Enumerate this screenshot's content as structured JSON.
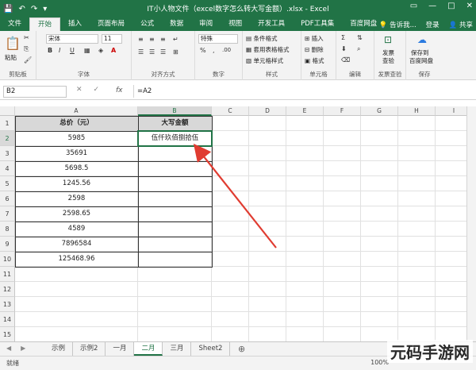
{
  "window": {
    "title": "IT小人物文件（excel数字怎么转大写金额）.xlsx - Excel",
    "min": "—",
    "max": "□",
    "close": "✕",
    "restore": "▭"
  },
  "quick_access": {
    "save": "💾",
    "undo": "↶",
    "redo": "↷",
    "more": "▾"
  },
  "tabs": [
    "文件",
    "开始",
    "插入",
    "页面布局",
    "公式",
    "数据",
    "审阅",
    "视图",
    "开发工具",
    "PDF工具集",
    "百度网盘"
  ],
  "tell_me": "告诉我...",
  "login": "登录",
  "share": "共享",
  "ribbon": {
    "clipboard": {
      "paste": "粘贴",
      "label": "剪贴板"
    },
    "font": {
      "name": "宋体",
      "size": "11",
      "bold": "B",
      "italic": "I",
      "underline": "U",
      "label": "字体"
    },
    "align": {
      "label": "对齐方式"
    },
    "number": {
      "format": "特殊",
      "label": "数字"
    },
    "styles": {
      "cond": "条件格式",
      "table": "套用表格格式",
      "cell": "单元格样式",
      "label": "样式"
    },
    "cells": {
      "insert": "插入",
      "delete": "删除",
      "format": "格式",
      "label": "单元格"
    },
    "edit": {
      "label": "编辑"
    },
    "invoice": {
      "text": "发票查验",
      "line1": "发票",
      "line2": "查验"
    },
    "save": {
      "line1": "保存到",
      "line2": "百度网盘",
      "label": "保存"
    }
  },
  "formula_bar": {
    "name_box": "B2",
    "cancel": "✕",
    "enter": "✓",
    "fx": "fx",
    "formula": "=A2"
  },
  "columns": [
    "A",
    "B",
    "C",
    "D",
    "E",
    "F",
    "G",
    "H",
    "I"
  ],
  "rows": [
    "1",
    "2",
    "3",
    "4",
    "5",
    "6",
    "7",
    "8",
    "9",
    "10",
    "11",
    "12",
    "13",
    "14",
    "15"
  ],
  "table": {
    "header_a": "总价（元）",
    "header_b": "大写金额",
    "values_a": [
      "5985",
      "35691",
      "5698.5",
      "1245.56",
      "2598",
      "2598.65",
      "4589",
      "7896584",
      "125468.96"
    ],
    "b2": "伍仟玖佰捌拾伍"
  },
  "sheets": [
    "示例",
    "示例2",
    "一月",
    "二月",
    "三月",
    "Sheet2"
  ],
  "active_sheet": 3,
  "add_sheet": "⊕",
  "status": "就绪",
  "zoom": "100%",
  "watermark": "元码手游网",
  "colors": {
    "excel_green": "#217346",
    "arrow_red": "#e03c31"
  }
}
